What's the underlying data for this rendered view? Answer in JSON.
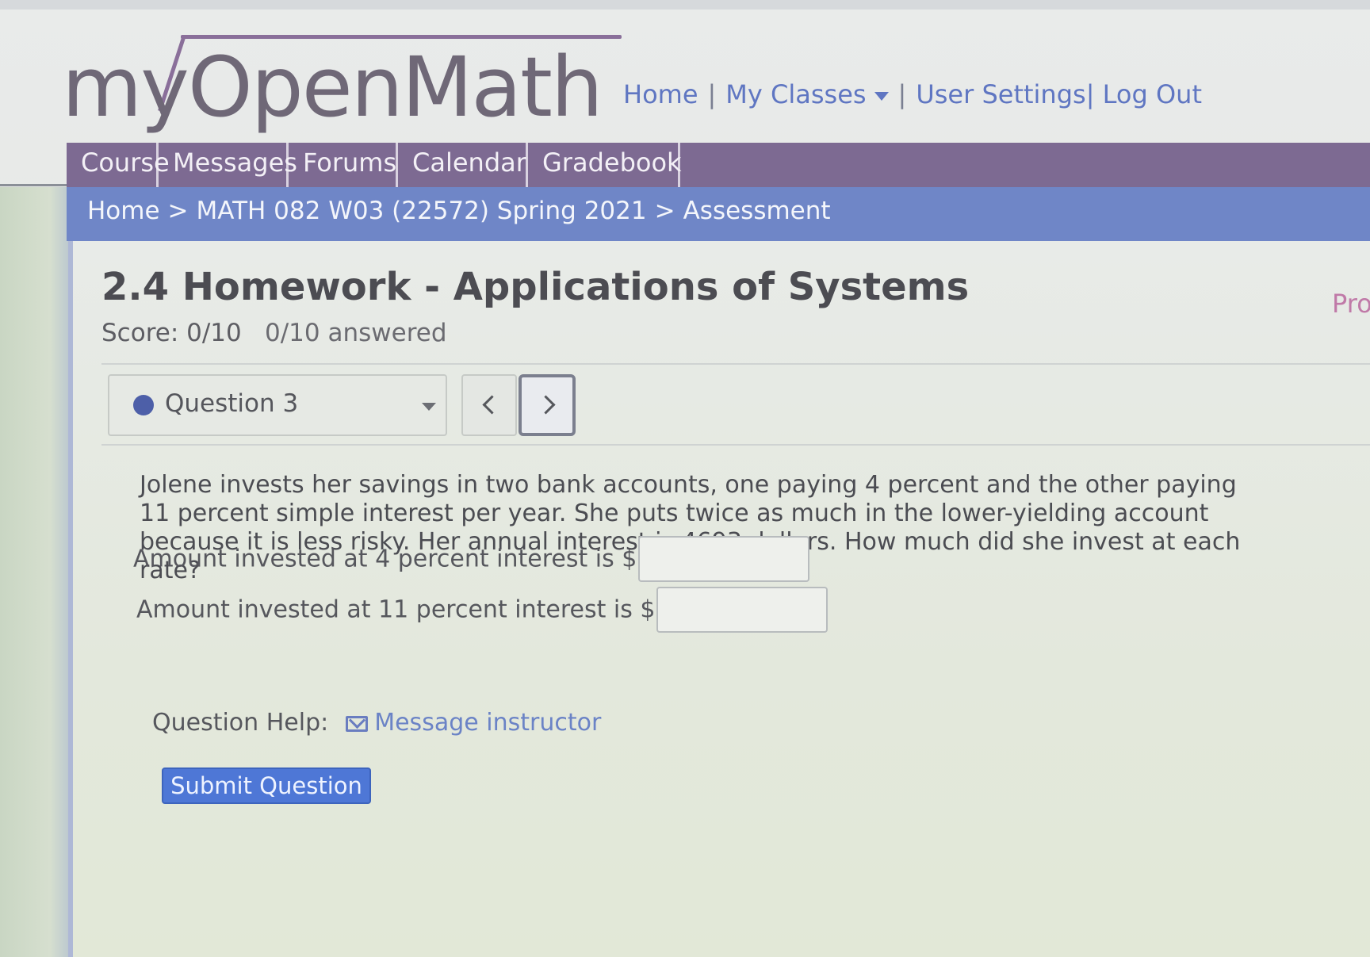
{
  "logo": {
    "text": "myOpenMath"
  },
  "top_links": {
    "home": "Home",
    "sep1": "|",
    "my_classes": "My Classes",
    "sep2": "|",
    "user_settings": "User Settings|",
    "log_out": "Log Out"
  },
  "nav_tabs": [
    "Course",
    "Messages",
    "Forums",
    "Calendar",
    "Gradebook"
  ],
  "breadcrumb": {
    "home": "Home",
    "separator": ">",
    "course": "MATH 082 W03 (22572) Spring 2021",
    "current": "Assessment"
  },
  "assessment": {
    "title": "2.4 Homework - Applications of Systems",
    "score": "Score: 0/10",
    "answered": "0/10 answered",
    "side_link": "Pro"
  },
  "question_nav": {
    "selected": "Question 3"
  },
  "question": {
    "text": "Jolene invests her savings in two bank accounts, one paying 4 percent and the other paying 11 percent simple interest per year. She puts twice as much in the lower-yielding account because it is less risky. Her annual interest is 4693 dollars. How much did she invest at each rate?",
    "answer1_prompt": "Amount invested at 4 percent interest is $",
    "answer1_value": "",
    "answer2_prompt": "Amount invested at 11 percent interest is $",
    "answer2_value": ""
  },
  "help": {
    "label": "Question Help:",
    "link": "Message instructor",
    "icon": "mail-icon"
  },
  "submit": {
    "label": "Submit Question"
  },
  "colors": {
    "nav_purple": "#7d6a92",
    "breadcrumb_blue": "#6f86c7",
    "link_blue": "#5f76c2",
    "submit_blue": "#4e77d6",
    "status_dot": "#4d5fa8"
  }
}
